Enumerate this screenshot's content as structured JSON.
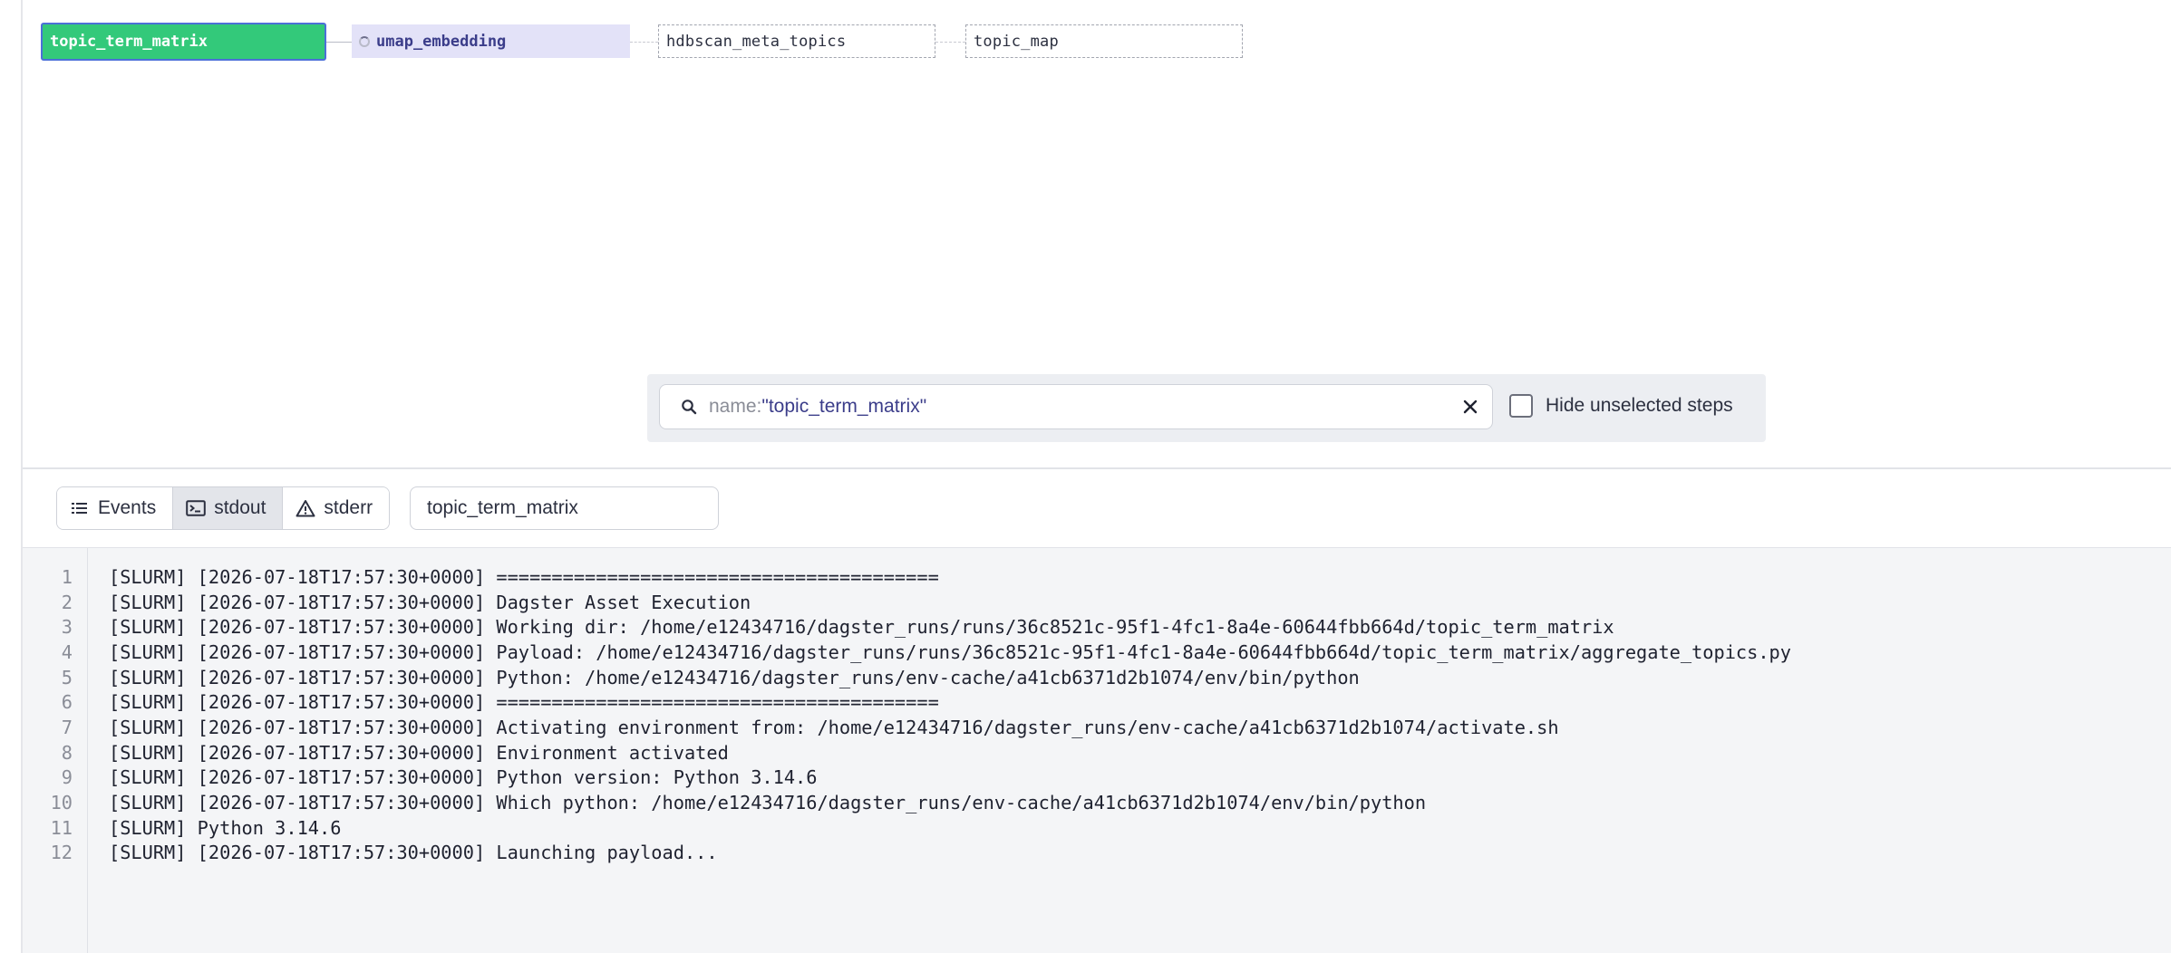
{
  "graph": {
    "nodes": [
      {
        "label": "topic_term_matrix",
        "state": "selected"
      },
      {
        "label": "umap_embedding",
        "state": "running"
      },
      {
        "label": "hdbscan_meta_topics",
        "state": "pending"
      },
      {
        "label": "topic_map",
        "state": "pending"
      }
    ]
  },
  "filter": {
    "query_key": "name:",
    "query_value": "\"topic_term_matrix\"",
    "hide_unselected_label": "Hide unselected steps",
    "hide_unselected_checked": false
  },
  "toolbar": {
    "tabs": [
      {
        "label": "Events",
        "icon": "list-icon",
        "active": false
      },
      {
        "label": "stdout",
        "icon": "terminal-icon",
        "active": true
      },
      {
        "label": "stderr",
        "icon": "warning-icon",
        "active": false
      }
    ],
    "step_select_value": "topic_term_matrix"
  },
  "log": {
    "lines": [
      {
        "n": "1",
        "text": "[SLURM] [2026-07-18T17:57:30+0000] ========================================"
      },
      {
        "n": "2",
        "text": "[SLURM] [2026-07-18T17:57:30+0000] Dagster Asset Execution"
      },
      {
        "n": "3",
        "text": "[SLURM] [2026-07-18T17:57:30+0000] Working dir: /home/e12434716/dagster_runs/runs/36c8521c-95f1-4fc1-8a4e-60644fbb664d/topic_term_matrix"
      },
      {
        "n": "4",
        "text": "[SLURM] [2026-07-18T17:57:30+0000] Payload: /home/e12434716/dagster_runs/runs/36c8521c-95f1-4fc1-8a4e-60644fbb664d/topic_term_matrix/aggregate_topics.py"
      },
      {
        "n": "5",
        "text": "[SLURM] [2026-07-18T17:57:30+0000] Python: /home/e12434716/dagster_runs/env-cache/a41cb6371d2b1074/env/bin/python"
      },
      {
        "n": "6",
        "text": "[SLURM] [2026-07-18T17:57:30+0000] ========================================"
      },
      {
        "n": "7",
        "text": "[SLURM] [2026-07-18T17:57:30+0000] Activating environment from: /home/e12434716/dagster_runs/env-cache/a41cb6371d2b1074/activate.sh"
      },
      {
        "n": "8",
        "text": "[SLURM] [2026-07-18T17:57:30+0000] Environment activated"
      },
      {
        "n": "9",
        "text": "[SLURM] [2026-07-18T17:57:30+0000] Python version: Python 3.14.6"
      },
      {
        "n": "10",
        "text": "[SLURM] [2026-07-18T17:57:30+0000] Which python: /home/e12434716/dagster_runs/env-cache/a41cb6371d2b1074/env/bin/python"
      },
      {
        "n": "11",
        "text": "[SLURM] Python 3.14.6"
      },
      {
        "n": "12",
        "text": "[SLURM] [2026-07-18T17:57:30+0000] Launching payload..."
      }
    ]
  },
  "colors": {
    "selected_node": "#33c97a",
    "selected_border": "#4c6fd8",
    "running_node": "#e3e2f8",
    "running_text": "#3b3d8a",
    "log_background": "#f4f5f7"
  }
}
